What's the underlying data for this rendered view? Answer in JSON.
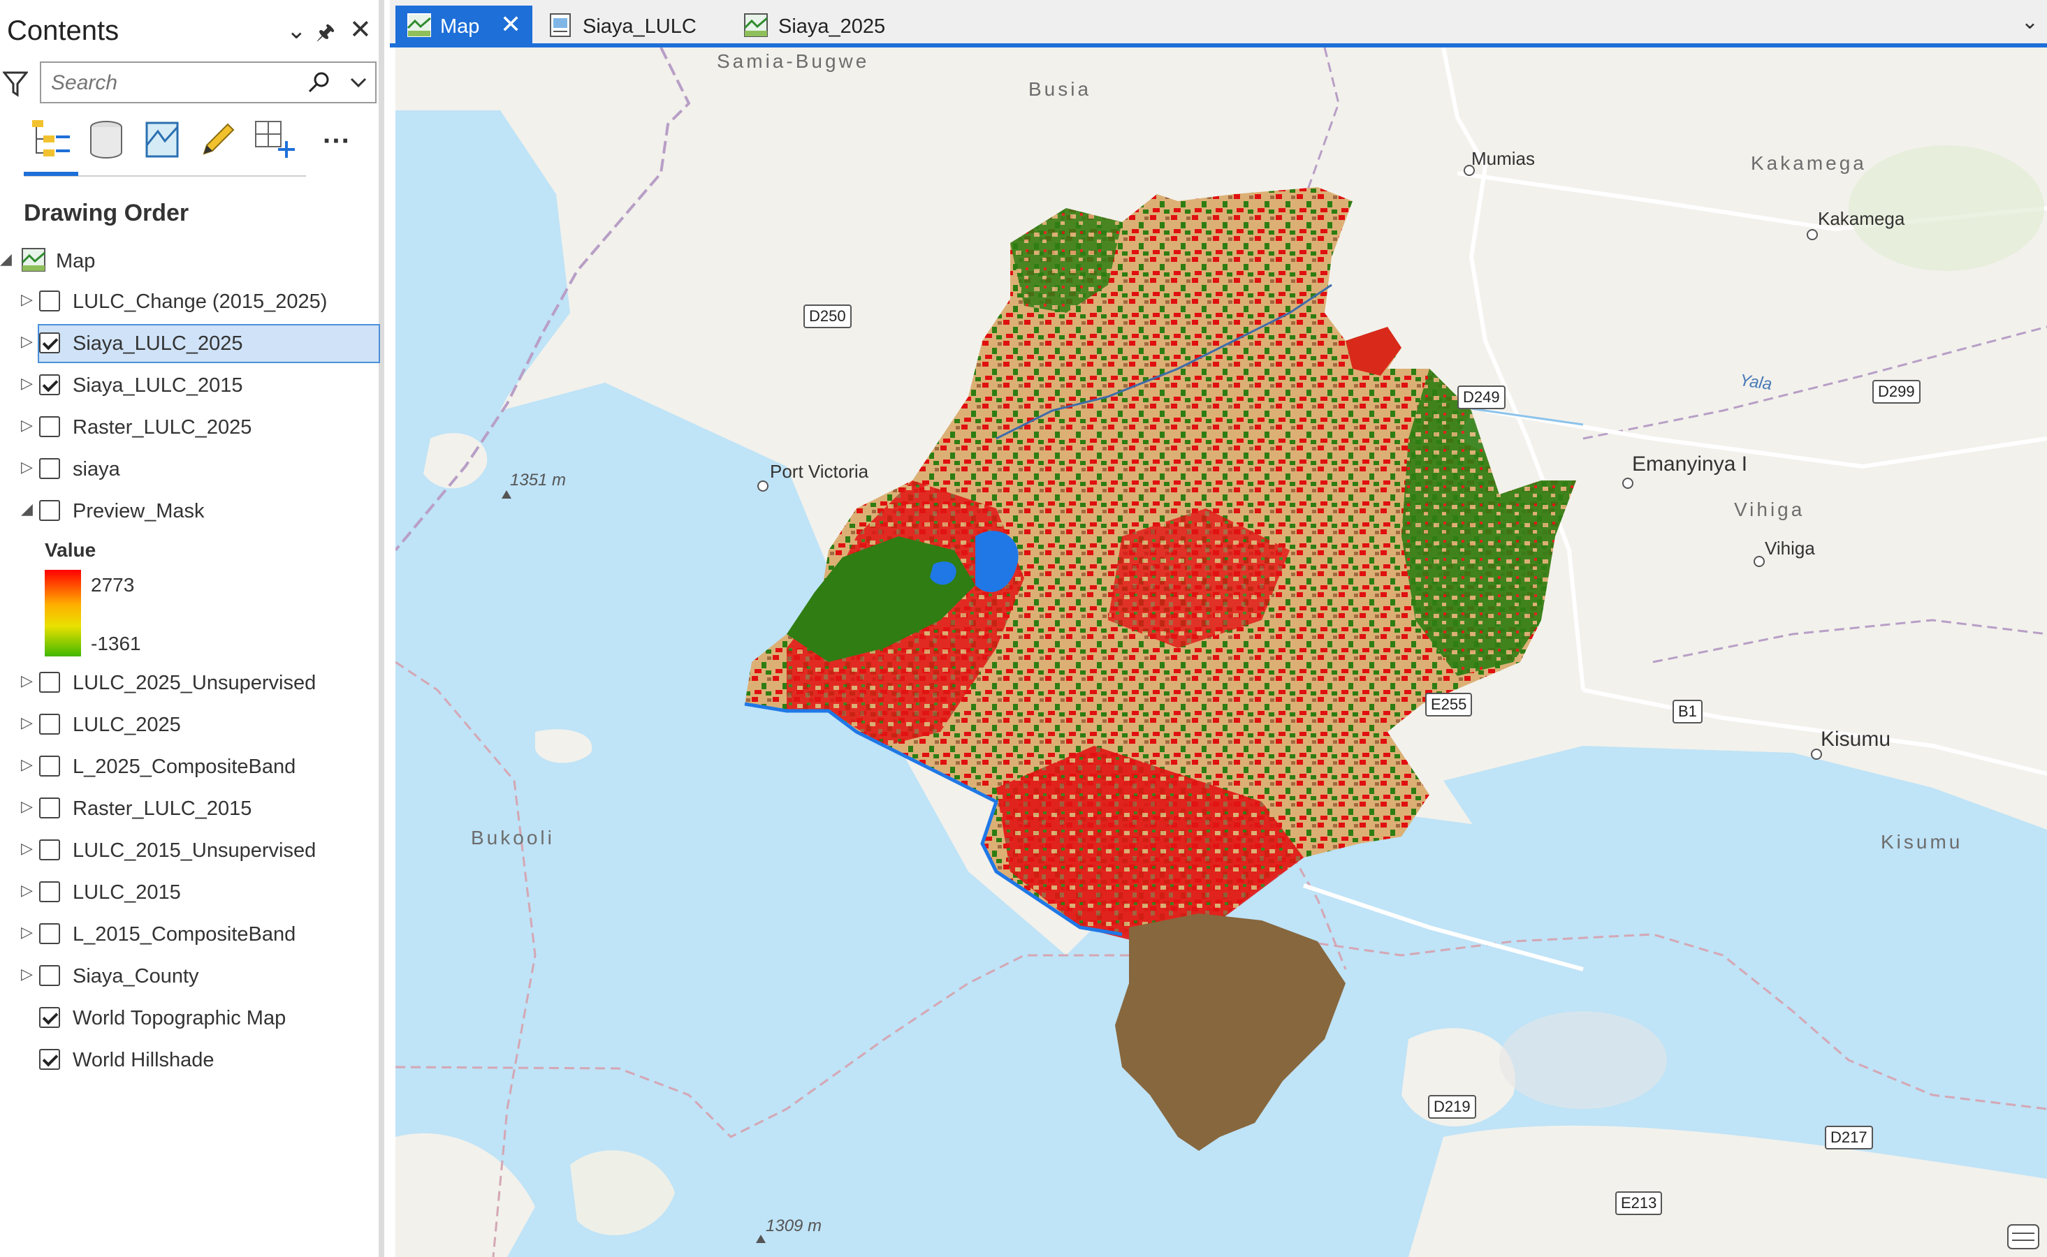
{
  "contents": {
    "title": "Contents",
    "search_placeholder": "Search",
    "drawing_order": "Drawing Order",
    "map_label": "Map",
    "layers": [
      {
        "name": "LULC_Change (2015_2025)",
        "checked": false,
        "expander": "collapsed",
        "selected": false
      },
      {
        "name": "Siaya_LULC_2025",
        "checked": true,
        "expander": "collapsed",
        "selected": true
      },
      {
        "name": "Siaya_LULC_2015",
        "checked": true,
        "expander": "collapsed",
        "selected": false
      },
      {
        "name": "Raster_LULC_2025",
        "checked": false,
        "expander": "collapsed",
        "selected": false
      },
      {
        "name": "siaya",
        "checked": false,
        "expander": "collapsed",
        "selected": false
      },
      {
        "name": "Preview_Mask",
        "checked": false,
        "expander": "expanded",
        "selected": false
      },
      {
        "name": "LULC_2025_Unsupervised",
        "checked": false,
        "expander": "collapsed",
        "selected": false
      },
      {
        "name": "LULC_2025",
        "checked": false,
        "expander": "collapsed",
        "selected": false
      },
      {
        "name": "L_2025_CompositeBand",
        "checked": false,
        "expander": "collapsed",
        "selected": false
      },
      {
        "name": "Raster_LULC_2015",
        "checked": false,
        "expander": "collapsed",
        "selected": false
      },
      {
        "name": "LULC_2015_Unsupervised",
        "checked": false,
        "expander": "collapsed",
        "selected": false
      },
      {
        "name": "LULC_2015",
        "checked": false,
        "expander": "collapsed",
        "selected": false
      },
      {
        "name": "L_2015_CompositeBand",
        "checked": false,
        "expander": "collapsed",
        "selected": false
      },
      {
        "name": "Siaya_County",
        "checked": false,
        "expander": "collapsed",
        "selected": false
      },
      {
        "name": "World Topographic Map",
        "checked": true,
        "expander": "none",
        "selected": false
      },
      {
        "name": "World Hillshade",
        "checked": true,
        "expander": "none",
        "selected": false
      }
    ],
    "legend": {
      "title": "Value",
      "max": "2773",
      "min": "-1361"
    }
  },
  "tabs": [
    {
      "label": "Map",
      "active": true
    },
    {
      "label": "Siaya_LULC",
      "active": false
    },
    {
      "label": "Siaya_2025",
      "active": false
    }
  ],
  "map": {
    "regions": [
      "Samia-Bugwe",
      "Busia",
      "Kakamega",
      "Vihiga",
      "Bukooli",
      "Kisumu"
    ],
    "places": [
      "Mumias",
      "Kakamega",
      "Port Victoria",
      "Emanyinya I",
      "Vihiga",
      "Kisumu"
    ],
    "elevations": [
      "1351 m",
      "1309 m"
    ],
    "roads": [
      "D250",
      "D249",
      "D299",
      "E255",
      "B1",
      "D219",
      "D217",
      "E213"
    ],
    "river": "Yala",
    "colors": {
      "water": "#bfe3f7",
      "land": "#f2f1ec",
      "forest": "#2e7d12",
      "cropland": "#e0b679",
      "builtup": "#e40f0f",
      "bare": "#87673e",
      "waterbody": "#1f78e6"
    }
  }
}
